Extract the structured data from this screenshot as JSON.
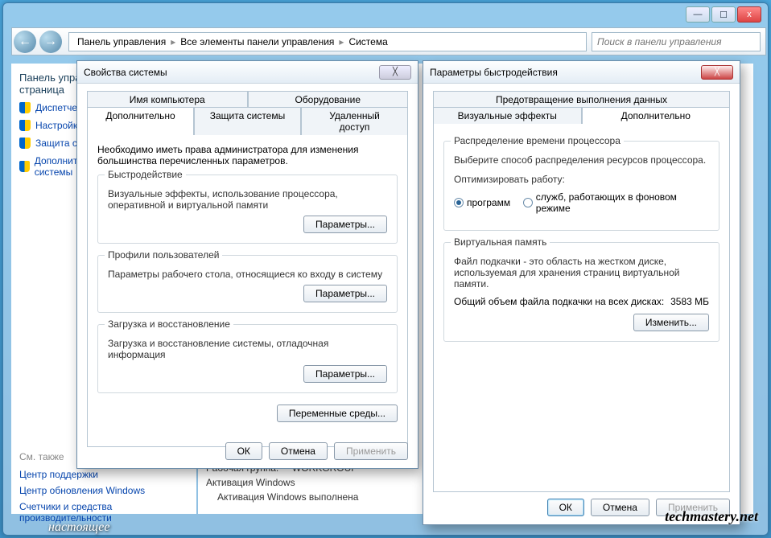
{
  "titlebar": {
    "min": "—",
    "max": "☐",
    "close": "x"
  },
  "breadcrumb": {
    "p1": "Панель управления",
    "p2": "Все элементы панели управления",
    "p3": "Система"
  },
  "search": {
    "placeholder": "Поиск в панели управления"
  },
  "left_panel": {
    "heading": "Панель управления — домашняя страница",
    "links": [
      "Диспетчер устройств",
      "Настройка удаленного доступа",
      "Защита системы",
      "Дополнительные параметры системы"
    ],
    "see_also": "См. также",
    "plain_links": [
      "Центр поддержки",
      "Центр обновления Windows",
      "Счетчики и средства производительности"
    ]
  },
  "main_bottom": {
    "line1_label": "Рабочая группа:",
    "line1_val": "WORKGROUP",
    "line2": "Активация Windows",
    "line3": "Активация Windows выполнена"
  },
  "dlg1": {
    "title": "Свойства системы",
    "tabs_top": [
      "Имя компьютера",
      "Оборудование"
    ],
    "tabs_bottom": [
      "Дополнительно",
      "Защита системы",
      "Удаленный доступ"
    ],
    "intro": "Необходимо иметь права администратора для изменения большинства перечисленных параметров.",
    "g1_title": "Быстродействие",
    "g1_text": "Визуальные эффекты, использование процессора, оперативной и виртуальной памяти",
    "g2_title": "Профили пользователей",
    "g2_text": "Параметры рабочего стола, относящиеся ко входу в систему",
    "g3_title": "Загрузка и восстановление",
    "g3_text": "Загрузка и восстановление системы, отладочная информация",
    "params_btn": "Параметры...",
    "env_btn": "Переменные среды...",
    "ok": "ОК",
    "cancel": "Отмена",
    "apply": "Применить"
  },
  "dlg2": {
    "title": "Параметры быстродействия",
    "tabs_top": [
      "Предотвращение выполнения данных"
    ],
    "tabs_bottom": [
      "Визуальные эффекты",
      "Дополнительно"
    ],
    "g1_title": "Распределение времени процессора",
    "g1_text": "Выберите способ распределения ресурсов процессора.",
    "opt_label": "Оптимизировать работу:",
    "opt1": "программ",
    "opt2": "служб, работающих в фоновом режиме",
    "g2_title": "Виртуальная память",
    "g2_text": "Файл подкачки - это область на жестком диске, используемая для хранения страниц виртуальной памяти.",
    "g2_total_label": "Общий объем файла подкачки на всех дисках:",
    "g2_total_val": "3583 МБ",
    "change_btn": "Изменить...",
    "ok": "ОК",
    "cancel": "Отмена",
    "apply": "Применить"
  },
  "watermark": "techmastery.net",
  "taskbar": "настоящее"
}
